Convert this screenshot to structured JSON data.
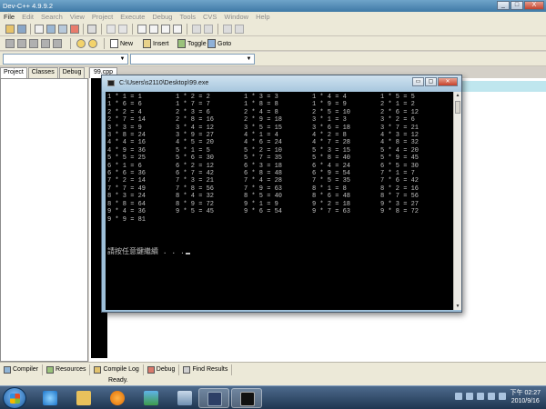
{
  "ide": {
    "title": "Dev-C++ 4.9.9.2",
    "window_controls": [
      "_",
      "□",
      "X"
    ],
    "menu": [
      "File",
      "Edit",
      "Search",
      "View",
      "Project",
      "Execute",
      "Debug",
      "Tools",
      "CVS",
      "Window",
      "Help"
    ],
    "toolbar_buttons": {
      "new": "New",
      "insert": "Insert",
      "toggle": "Toggle",
      "goto": "Goto"
    },
    "left_tabs": [
      "Project",
      "Classes",
      "Debug"
    ],
    "editor_tab": "99.cpp",
    "bottom_tabs": [
      "Compiler",
      "Resources",
      "Compile Log",
      "Debug",
      "Find Results"
    ],
    "status": "Ready."
  },
  "console": {
    "title": "C:\\Users\\s2110\\Desktop\\99.exe",
    "controls": [
      "▭",
      "▢",
      "✕"
    ],
    "rows": [
      [
        "1 * 1 = 1",
        "1 * 2 = 2",
        "1 * 3 = 3",
        "1 * 4 = 4",
        "1 * 5 = 5"
      ],
      [
        "1 * 6 = 6",
        "1 * 7 = 7",
        "1 * 8 = 8",
        "1 * 9 = 9",
        "2 * 1 = 2"
      ],
      [
        "2 * 2 = 4",
        "2 * 3 = 6",
        "2 * 4 = 8",
        "2 * 5 = 10",
        "2 * 6 = 12"
      ],
      [
        "2 * 7 = 14",
        "2 * 8 = 16",
        "2 * 9 = 18",
        "3 * 1 = 3",
        "3 * 2 = 6"
      ],
      [
        "3 * 3 = 9",
        "3 * 4 = 12",
        "3 * 5 = 15",
        "3 * 6 = 18",
        "3 * 7 = 21"
      ],
      [
        "3 * 8 = 24",
        "3 * 9 = 27",
        "4 * 1 = 4",
        "4 * 2 = 8",
        "4 * 3 = 12"
      ],
      [
        "4 * 4 = 16",
        "4 * 5 = 20",
        "4 * 6 = 24",
        "4 * 7 = 28",
        "4 * 8 = 32"
      ],
      [
        "4 * 9 = 36",
        "5 * 1 = 5",
        "5 * 2 = 10",
        "5 * 3 = 15",
        "5 * 4 = 20"
      ],
      [
        "5 * 5 = 25",
        "5 * 6 = 30",
        "5 * 7 = 35",
        "5 * 8 = 40",
        "5 * 9 = 45"
      ],
      [
        "6 * 1 = 6",
        "6 * 2 = 12",
        "6 * 3 = 18",
        "6 * 4 = 24",
        "6 * 5 = 30"
      ],
      [
        "6 * 6 = 36",
        "6 * 7 = 42",
        "6 * 8 = 48",
        "6 * 9 = 54",
        "7 * 1 = 7"
      ],
      [
        "7 * 2 = 14",
        "7 * 3 = 21",
        "7 * 4 = 28",
        "7 * 5 = 35",
        "7 * 6 = 42"
      ],
      [
        "7 * 7 = 49",
        "7 * 8 = 56",
        "7 * 9 = 63",
        "8 * 1 = 8",
        "8 * 2 = 16"
      ],
      [
        "8 * 3 = 24",
        "8 * 4 = 32",
        "8 * 5 = 40",
        "8 * 6 = 48",
        "8 * 7 = 56"
      ],
      [
        "8 * 8 = 64",
        "8 * 9 = 72",
        "9 * 1 = 9",
        "9 * 2 = 18",
        "9 * 3 = 27"
      ],
      [
        "9 * 4 = 36",
        "9 * 5 = 45",
        "9 * 6 = 54",
        "9 * 7 = 63",
        "9 * 8 = 72"
      ],
      [
        "9 * 9 = 81",
        "",
        "",
        "",
        ""
      ]
    ],
    "prompt": "請按任意鍵繼續 . . ."
  },
  "taskbar": {
    "time": "下午 02:27",
    "date": "2010/9/16",
    "apps": [
      "ie-icon",
      "explorer-icon",
      "media-player-icon",
      "messenger-icon",
      "window-icon",
      "devcpp-icon",
      "console-icon"
    ],
    "accent": "#1f3651"
  }
}
